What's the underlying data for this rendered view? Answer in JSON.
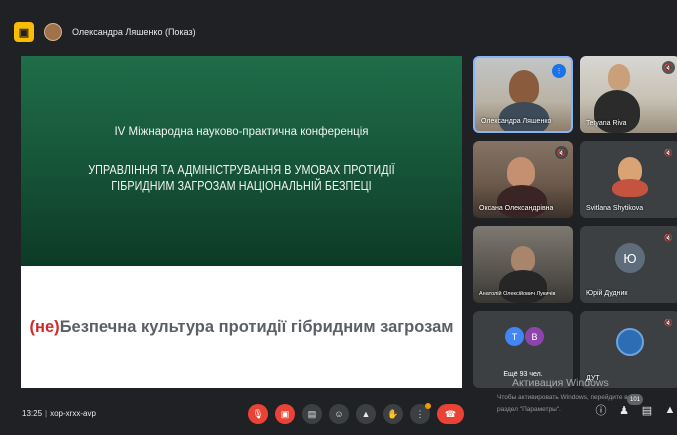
{
  "topbar": {
    "presenter_name": "Олександра Ляшенко (Показ)",
    "present_icon": "present-to-all-icon"
  },
  "slide": {
    "conference": "IV Міжнародна науково-практична конференція",
    "title_line1": "УПРАВЛІННЯ ТА АДМІНІСТРУВАННЯ В УМОВАХ ПРОТИДІЇ",
    "title_line2": "ГІБРИДНИМ ЗАГРОЗАМ НАЦІОНАЛЬНІЙ БЕЗПЕЦІ",
    "bottom_prefix": "(не)",
    "bottom_rest": "Безпечна культура протидії гібридним загрозам"
  },
  "participants": [
    {
      "name": "Олександра Ляшенко"
    },
    {
      "name": "Tetyana Riva"
    },
    {
      "name": "Оксана Олександрівна"
    },
    {
      "name": "Svitlana Shytikova"
    },
    {
      "name": "Анатолій Олексійович Лукичів"
    },
    {
      "name": "Юрій Дудник",
      "initial": "Ю"
    },
    {
      "name": "Ещё 93 чел.",
      "initials": [
        "Т",
        "В"
      ]
    },
    {
      "name": "ДУТ"
    }
  ],
  "overlay": {
    "activate": "Активация Windows",
    "line1": "Чтобы активировать Windows, перейдите в",
    "line2": "раздел \"Параметры\"."
  },
  "bottombar": {
    "time": "13:25",
    "meeting_code": "xop-xrxx-avp",
    "participant_count": "101"
  },
  "colors": {
    "background": "#202124",
    "tile": "#3c4043",
    "end_call": "#ea4335",
    "speaking": "#1a73e8",
    "slide_green": "#17583a",
    "accent_red": "#cf2a2a"
  }
}
